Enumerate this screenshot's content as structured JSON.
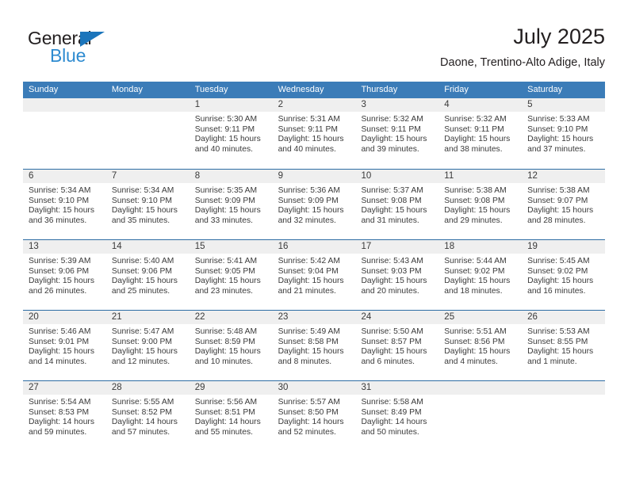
{
  "brand": {
    "name_part1": "General",
    "name_part2": "Blue",
    "triangle_color": "#1b75bb",
    "blue_color": "#2e8bd0"
  },
  "header": {
    "title": "July 2025",
    "subtitle": "Daone, Trentino-Alto Adige, Italy"
  },
  "theme": {
    "header_blue": "#3b7cb8",
    "week_divider": "#2e6da4",
    "daynum_band": "#efefef",
    "text": "#3a3a3a"
  },
  "weekdays": [
    "Sunday",
    "Monday",
    "Tuesday",
    "Wednesday",
    "Thursday",
    "Friday",
    "Saturday"
  ],
  "weeks": [
    [
      {
        "day": ""
      },
      {
        "day": ""
      },
      {
        "day": "1",
        "sunrise": "Sunrise: 5:30 AM",
        "sunset": "Sunset: 9:11 PM",
        "daylight_1": "Daylight: 15 hours",
        "daylight_2": "and 40 minutes."
      },
      {
        "day": "2",
        "sunrise": "Sunrise: 5:31 AM",
        "sunset": "Sunset: 9:11 PM",
        "daylight_1": "Daylight: 15 hours",
        "daylight_2": "and 40 minutes."
      },
      {
        "day": "3",
        "sunrise": "Sunrise: 5:32 AM",
        "sunset": "Sunset: 9:11 PM",
        "daylight_1": "Daylight: 15 hours",
        "daylight_2": "and 39 minutes."
      },
      {
        "day": "4",
        "sunrise": "Sunrise: 5:32 AM",
        "sunset": "Sunset: 9:11 PM",
        "daylight_1": "Daylight: 15 hours",
        "daylight_2": "and 38 minutes."
      },
      {
        "day": "5",
        "sunrise": "Sunrise: 5:33 AM",
        "sunset": "Sunset: 9:10 PM",
        "daylight_1": "Daylight: 15 hours",
        "daylight_2": "and 37 minutes."
      }
    ],
    [
      {
        "day": "6",
        "sunrise": "Sunrise: 5:34 AM",
        "sunset": "Sunset: 9:10 PM",
        "daylight_1": "Daylight: 15 hours",
        "daylight_2": "and 36 minutes."
      },
      {
        "day": "7",
        "sunrise": "Sunrise: 5:34 AM",
        "sunset": "Sunset: 9:10 PM",
        "daylight_1": "Daylight: 15 hours",
        "daylight_2": "and 35 minutes."
      },
      {
        "day": "8",
        "sunrise": "Sunrise: 5:35 AM",
        "sunset": "Sunset: 9:09 PM",
        "daylight_1": "Daylight: 15 hours",
        "daylight_2": "and 33 minutes."
      },
      {
        "day": "9",
        "sunrise": "Sunrise: 5:36 AM",
        "sunset": "Sunset: 9:09 PM",
        "daylight_1": "Daylight: 15 hours",
        "daylight_2": "and 32 minutes."
      },
      {
        "day": "10",
        "sunrise": "Sunrise: 5:37 AM",
        "sunset": "Sunset: 9:08 PM",
        "daylight_1": "Daylight: 15 hours",
        "daylight_2": "and 31 minutes."
      },
      {
        "day": "11",
        "sunrise": "Sunrise: 5:38 AM",
        "sunset": "Sunset: 9:08 PM",
        "daylight_1": "Daylight: 15 hours",
        "daylight_2": "and 29 minutes."
      },
      {
        "day": "12",
        "sunrise": "Sunrise: 5:38 AM",
        "sunset": "Sunset: 9:07 PM",
        "daylight_1": "Daylight: 15 hours",
        "daylight_2": "and 28 minutes."
      }
    ],
    [
      {
        "day": "13",
        "sunrise": "Sunrise: 5:39 AM",
        "sunset": "Sunset: 9:06 PM",
        "daylight_1": "Daylight: 15 hours",
        "daylight_2": "and 26 minutes."
      },
      {
        "day": "14",
        "sunrise": "Sunrise: 5:40 AM",
        "sunset": "Sunset: 9:06 PM",
        "daylight_1": "Daylight: 15 hours",
        "daylight_2": "and 25 minutes."
      },
      {
        "day": "15",
        "sunrise": "Sunrise: 5:41 AM",
        "sunset": "Sunset: 9:05 PM",
        "daylight_1": "Daylight: 15 hours",
        "daylight_2": "and 23 minutes."
      },
      {
        "day": "16",
        "sunrise": "Sunrise: 5:42 AM",
        "sunset": "Sunset: 9:04 PM",
        "daylight_1": "Daylight: 15 hours",
        "daylight_2": "and 21 minutes."
      },
      {
        "day": "17",
        "sunrise": "Sunrise: 5:43 AM",
        "sunset": "Sunset: 9:03 PM",
        "daylight_1": "Daylight: 15 hours",
        "daylight_2": "and 20 minutes."
      },
      {
        "day": "18",
        "sunrise": "Sunrise: 5:44 AM",
        "sunset": "Sunset: 9:02 PM",
        "daylight_1": "Daylight: 15 hours",
        "daylight_2": "and 18 minutes."
      },
      {
        "day": "19",
        "sunrise": "Sunrise: 5:45 AM",
        "sunset": "Sunset: 9:02 PM",
        "daylight_1": "Daylight: 15 hours",
        "daylight_2": "and 16 minutes."
      }
    ],
    [
      {
        "day": "20",
        "sunrise": "Sunrise: 5:46 AM",
        "sunset": "Sunset: 9:01 PM",
        "daylight_1": "Daylight: 15 hours",
        "daylight_2": "and 14 minutes."
      },
      {
        "day": "21",
        "sunrise": "Sunrise: 5:47 AM",
        "sunset": "Sunset: 9:00 PM",
        "daylight_1": "Daylight: 15 hours",
        "daylight_2": "and 12 minutes."
      },
      {
        "day": "22",
        "sunrise": "Sunrise: 5:48 AM",
        "sunset": "Sunset: 8:59 PM",
        "daylight_1": "Daylight: 15 hours",
        "daylight_2": "and 10 minutes."
      },
      {
        "day": "23",
        "sunrise": "Sunrise: 5:49 AM",
        "sunset": "Sunset: 8:58 PM",
        "daylight_1": "Daylight: 15 hours",
        "daylight_2": "and 8 minutes."
      },
      {
        "day": "24",
        "sunrise": "Sunrise: 5:50 AM",
        "sunset": "Sunset: 8:57 PM",
        "daylight_1": "Daylight: 15 hours",
        "daylight_2": "and 6 minutes."
      },
      {
        "day": "25",
        "sunrise": "Sunrise: 5:51 AM",
        "sunset": "Sunset: 8:56 PM",
        "daylight_1": "Daylight: 15 hours",
        "daylight_2": "and 4 minutes."
      },
      {
        "day": "26",
        "sunrise": "Sunrise: 5:53 AM",
        "sunset": "Sunset: 8:55 PM",
        "daylight_1": "Daylight: 15 hours",
        "daylight_2": "and 1 minute."
      }
    ],
    [
      {
        "day": "27",
        "sunrise": "Sunrise: 5:54 AM",
        "sunset": "Sunset: 8:53 PM",
        "daylight_1": "Daylight: 14 hours",
        "daylight_2": "and 59 minutes."
      },
      {
        "day": "28",
        "sunrise": "Sunrise: 5:55 AM",
        "sunset": "Sunset: 8:52 PM",
        "daylight_1": "Daylight: 14 hours",
        "daylight_2": "and 57 minutes."
      },
      {
        "day": "29",
        "sunrise": "Sunrise: 5:56 AM",
        "sunset": "Sunset: 8:51 PM",
        "daylight_1": "Daylight: 14 hours",
        "daylight_2": "and 55 minutes."
      },
      {
        "day": "30",
        "sunrise": "Sunrise: 5:57 AM",
        "sunset": "Sunset: 8:50 PM",
        "daylight_1": "Daylight: 14 hours",
        "daylight_2": "and 52 minutes."
      },
      {
        "day": "31",
        "sunrise": "Sunrise: 5:58 AM",
        "sunset": "Sunset: 8:49 PM",
        "daylight_1": "Daylight: 14 hours",
        "daylight_2": "and 50 minutes."
      },
      {
        "day": ""
      },
      {
        "day": ""
      }
    ]
  ]
}
